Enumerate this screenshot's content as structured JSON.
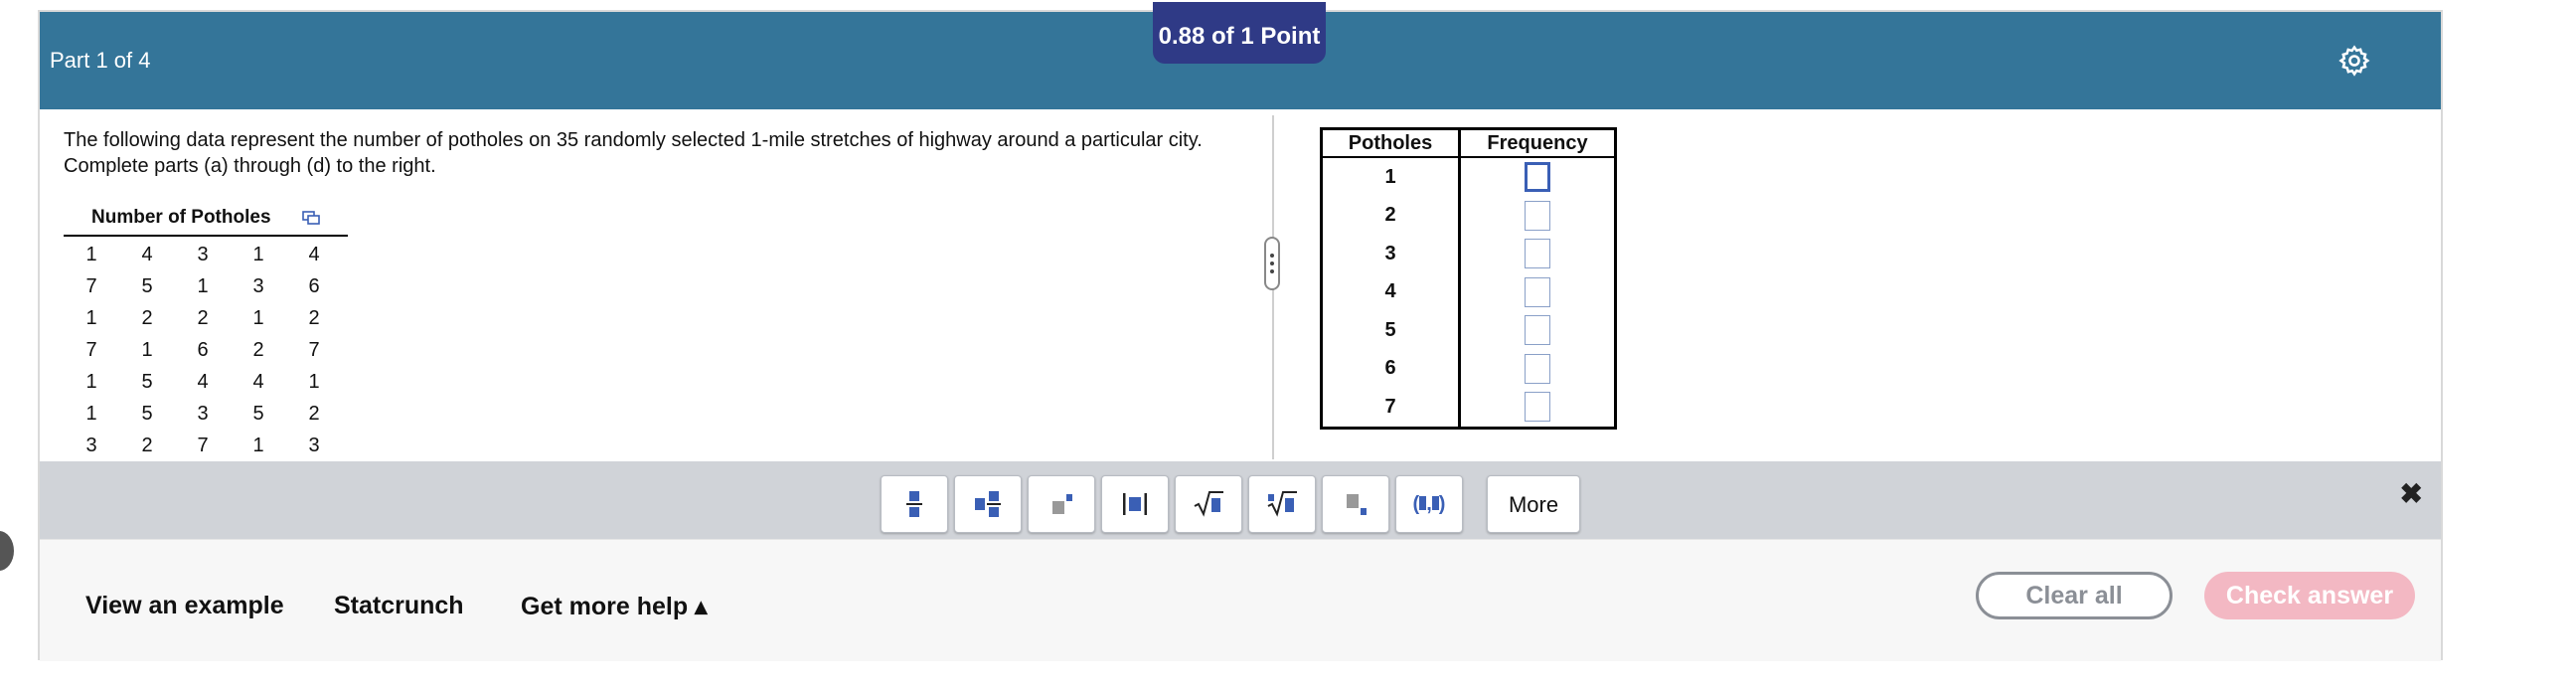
{
  "header": {
    "part_label": "Part 1 of 4",
    "score": "0.88 of 1 Point",
    "settings_icon": "gear-icon"
  },
  "question": {
    "prompt": "The following data represent the number of potholes on 35 randomly selected 1-mile stretches of highway around a particular city. Complete parts (a) through (d) to the right.",
    "data_title": "Number of Potholes",
    "data_rows": [
      [
        "1",
        "4",
        "3",
        "1",
        "4"
      ],
      [
        "7",
        "5",
        "1",
        "3",
        "6"
      ],
      [
        "1",
        "2",
        "2",
        "1",
        "2"
      ],
      [
        "7",
        "1",
        "6",
        "2",
        "7"
      ],
      [
        "1",
        "5",
        "4",
        "4",
        "1"
      ],
      [
        "1",
        "5",
        "3",
        "5",
        "2"
      ],
      [
        "3",
        "2",
        "7",
        "1",
        "3"
      ]
    ]
  },
  "frequency_table": {
    "col1": "Potholes",
    "col2": "Frequency",
    "rows": [
      "1",
      "2",
      "3",
      "4",
      "5",
      "6",
      "7"
    ]
  },
  "toolbar": {
    "buttons": [
      "fraction",
      "mixed-number",
      "exponent",
      "absolute-value",
      "square-root",
      "nth-root",
      "subscript",
      "ordered-pair"
    ],
    "more_label": "More",
    "close_glyph": "✖"
  },
  "footer": {
    "view_example": "View an example",
    "statcrunch": "Statcrunch",
    "get_help": "Get more help ▴",
    "clear_all": "Clear all",
    "check_answer": "Check answer"
  },
  "colors": {
    "header_bg": "#347599",
    "score_bg": "#2f3a86",
    "check_btn_bg": "#f3b8c3",
    "toolbar_bg": "#d0d3d8"
  }
}
